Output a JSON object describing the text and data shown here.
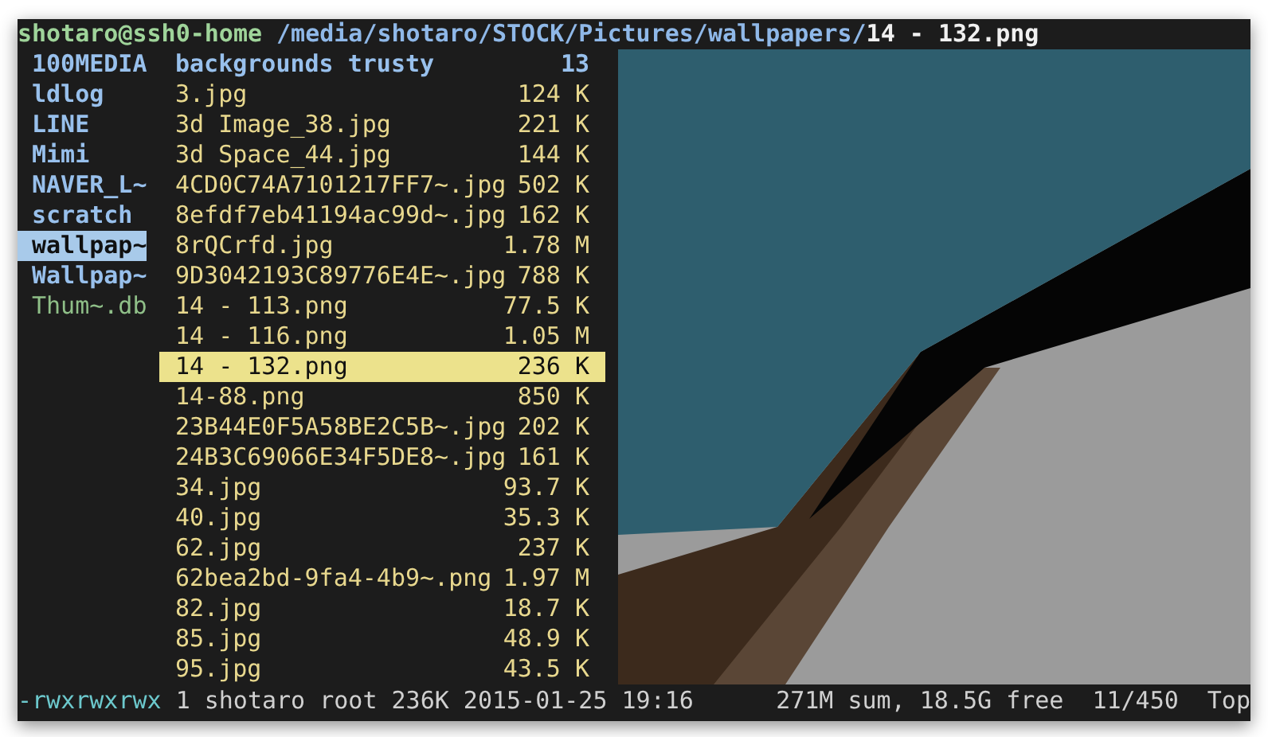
{
  "title_bar": {
    "user_host": "shotaro@ssh0-home",
    "directory": "/media/shotaro/STOCK/Pictures/wallpapers/",
    "file": "14 - 132.png"
  },
  "parent_column": [
    {
      "name": "100MEDIA",
      "kind": "dir",
      "selected": false
    },
    {
      "name": "ldlog",
      "kind": "dir",
      "selected": false
    },
    {
      "name": "LINE",
      "kind": "dir",
      "selected": false
    },
    {
      "name": "Mimi",
      "kind": "dir",
      "selected": false
    },
    {
      "name": "NAVER_L~",
      "kind": "dir",
      "selected": false
    },
    {
      "name": "scratch",
      "kind": "dir",
      "selected": false
    },
    {
      "name": "wallpap~",
      "kind": "dir",
      "selected": true
    },
    {
      "name": "Wallpap~",
      "kind": "dir",
      "selected": false
    },
    {
      "name": "Thum~.db",
      "kind": "file",
      "selected": false
    }
  ],
  "current_column": [
    {
      "name": "backgrounds trusty",
      "size": "13",
      "kind": "dir",
      "selected": false
    },
    {
      "name": "3.jpg",
      "size": "124 K",
      "kind": "file",
      "selected": false
    },
    {
      "name": "3d Image_38.jpg",
      "size": "221 K",
      "kind": "file",
      "selected": false
    },
    {
      "name": "3d Space_44.jpg",
      "size": "144 K",
      "kind": "file",
      "selected": false
    },
    {
      "name": "4CD0C74A7101217FF7~.jpg",
      "size": "502 K",
      "kind": "file",
      "selected": false
    },
    {
      "name": "8efdf7eb41194ac99d~.jpg",
      "size": "162 K",
      "kind": "file",
      "selected": false
    },
    {
      "name": "8rQCrfd.jpg",
      "size": "1.78 M",
      "kind": "file",
      "selected": false
    },
    {
      "name": "9D3042193C89776E4E~.jpg",
      "size": "788 K",
      "kind": "file",
      "selected": false
    },
    {
      "name": "14 - 113.png",
      "size": "77.5 K",
      "kind": "file",
      "selected": false
    },
    {
      "name": "14 - 116.png",
      "size": "1.05 M",
      "kind": "file",
      "selected": false
    },
    {
      "name": "14 - 132.png",
      "size": "236 K",
      "kind": "file",
      "selected": true
    },
    {
      "name": "14-88.png",
      "size": "850 K",
      "kind": "file",
      "selected": false
    },
    {
      "name": "23B44E0F5A58BE2C5B~.jpg",
      "size": "202 K",
      "kind": "file",
      "selected": false
    },
    {
      "name": "24B3C69066E34F5DE8~.jpg",
      "size": "161 K",
      "kind": "file",
      "selected": false
    },
    {
      "name": "34.jpg",
      "size": "93.7 K",
      "kind": "file",
      "selected": false
    },
    {
      "name": "40.jpg",
      "size": "35.3 K",
      "kind": "file",
      "selected": false
    },
    {
      "name": "62.jpg",
      "size": "237 K",
      "kind": "file",
      "selected": false
    },
    {
      "name": "62bea2bd-9fa4-4b9~.png",
      "size": "1.97 M",
      "kind": "file",
      "selected": false
    },
    {
      "name": "82.jpg",
      "size": "18.7 K",
      "kind": "file",
      "selected": false
    },
    {
      "name": "85.jpg",
      "size": "48.9 K",
      "kind": "file",
      "selected": false
    },
    {
      "name": "95.jpg",
      "size": "43.5 K",
      "kind": "file",
      "selected": false
    }
  ],
  "status_bar": {
    "permissions": "-rwxrwxrwx",
    "info": "1 shotaro root 236K 2015-01-25 19:16",
    "summary": "271M sum, 18.5G free",
    "position": "11/450",
    "scroll": "Top"
  }
}
